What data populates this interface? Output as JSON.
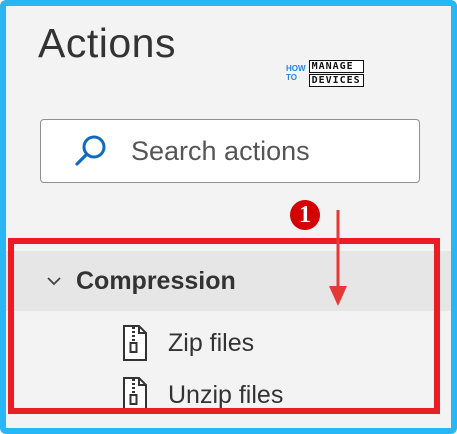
{
  "panel": {
    "title": "Actions"
  },
  "logo": {
    "how": "HOW",
    "to": "TO",
    "manage": "MANAGE",
    "devices": "DEVICES"
  },
  "search": {
    "placeholder": "Search actions"
  },
  "tree": {
    "group": {
      "label": "Compression",
      "expanded": true,
      "icon": "chevron-down-icon"
    },
    "items": [
      {
        "label": "Zip files",
        "icon": "zip-file-icon"
      },
      {
        "label": "Unzip files",
        "icon": "zip-file-icon"
      }
    ]
  },
  "annotation": {
    "step_number": "1",
    "highlight_color": "#ed1c24",
    "arrow_color": "#e53935"
  },
  "colors": {
    "frame_border": "#29b6f6",
    "panel_bg": "#f3f3f3",
    "accent_blue": "#0f6cbd"
  }
}
